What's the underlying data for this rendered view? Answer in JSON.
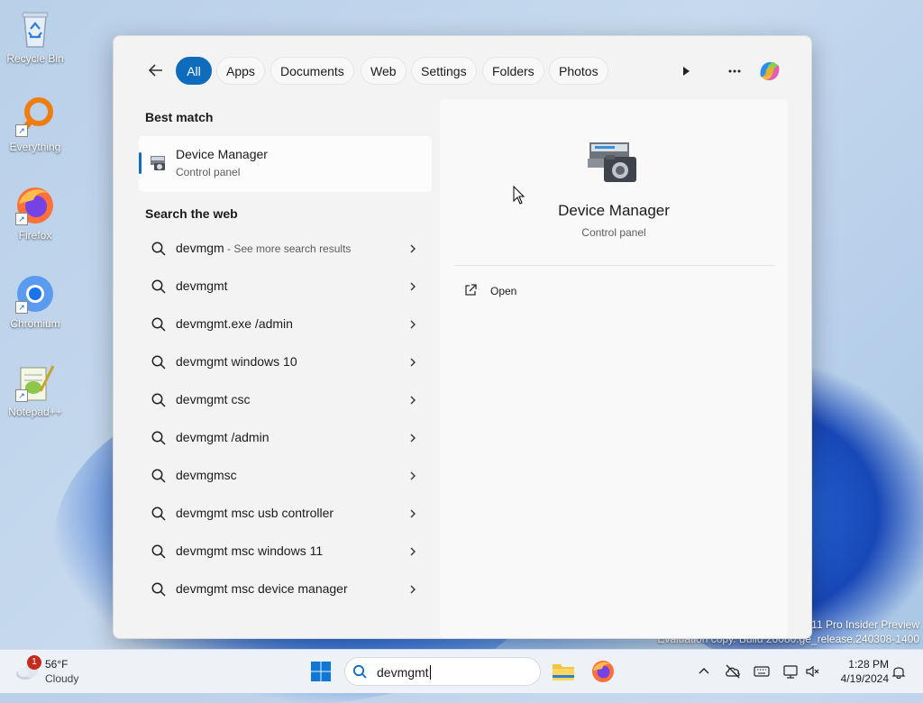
{
  "desktop": {
    "icons": [
      {
        "label": "Recycle Bin",
        "icon": "recycle-bin-icon"
      },
      {
        "label": "Everything",
        "icon": "everything-search-icon"
      },
      {
        "label": "Firefox",
        "icon": "firefox-icon"
      },
      {
        "label": "Chromium",
        "icon": "chromium-icon"
      },
      {
        "label": "Notepad++",
        "icon": "notepadpp-icon"
      }
    ],
    "watermark": {
      "line1": "11 Pro Insider Preview",
      "line2": "Evaluation copy. Build 26080.ge_release.240308-1400"
    }
  },
  "search_panel": {
    "filters": [
      "All",
      "Apps",
      "Documents",
      "Web",
      "Settings",
      "Folders",
      "Photos"
    ],
    "active_filter": "All",
    "best_match": {
      "heading": "Best match",
      "title": "Device Manager",
      "subtitle": "Control panel"
    },
    "web": {
      "heading": "Search the web",
      "results": [
        {
          "text": "devmgm",
          "suffix": " - See more search results"
        },
        {
          "text": "devmgmt",
          "suffix": ""
        },
        {
          "text": "devmgmt.exe /admin",
          "suffix": ""
        },
        {
          "text": "devmgmt windows 10",
          "suffix": ""
        },
        {
          "text": "devmgmt csc",
          "suffix": ""
        },
        {
          "text": "devmgmt /admin",
          "suffix": ""
        },
        {
          "text": "devmgmsc",
          "suffix": ""
        },
        {
          "text": "devmgmt msc usb controller",
          "suffix": ""
        },
        {
          "text": "devmgmt msc windows 11",
          "suffix": ""
        },
        {
          "text": "devmgmt msc device manager",
          "suffix": ""
        }
      ]
    },
    "preview": {
      "title": "Device Manager",
      "subtitle": "Control panel",
      "actions": [
        {
          "label": "Open",
          "icon": "open-external-icon"
        }
      ]
    }
  },
  "taskbar": {
    "weather": {
      "temp": "56°F",
      "condition": "Cloudy",
      "badge": "1"
    },
    "search_value": "devmgmt",
    "time": "1:28 PM",
    "date": "4/19/2024"
  },
  "colors": {
    "accent": "#0f6cbd",
    "panel": "#f3f3f3"
  }
}
